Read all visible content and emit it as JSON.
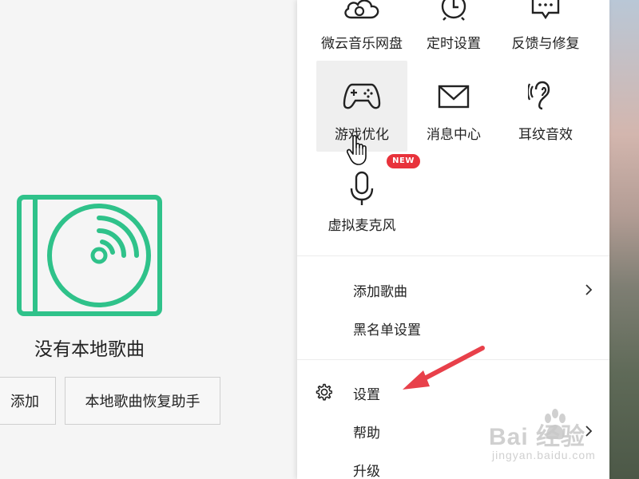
{
  "left_pane": {
    "empty_title": "没有本地歌曲",
    "add_label": "添加",
    "restore_label": "本地歌曲恢复助手"
  },
  "menu": {
    "tiles": [
      {
        "label": "微云音乐网盘",
        "icon": "cloud-icon"
      },
      {
        "label": "定时设置",
        "icon": "alarm-clock-icon"
      },
      {
        "label": "反馈与修复",
        "icon": "feedback-icon"
      },
      {
        "label": "游戏优化",
        "icon": "gamepad-icon",
        "hovered": true
      },
      {
        "label": "消息中心",
        "icon": "mail-icon"
      },
      {
        "label": "耳纹音效",
        "icon": "ear-icon"
      },
      {
        "label": "虚拟麦克风",
        "icon": "microphone-icon",
        "badge": "NEW"
      }
    ],
    "items": [
      {
        "label": "添加歌曲",
        "submenu": true
      },
      {
        "label": "黑名单设置",
        "submenu": false
      },
      {
        "label": "设置",
        "submenu": false,
        "icon": "gear-icon"
      },
      {
        "label": "帮助",
        "submenu": true
      },
      {
        "label": "升级",
        "submenu": false
      }
    ]
  },
  "watermark": {
    "brand": "Bai  经验",
    "site": "jingyan.baidu.com"
  },
  "colors": {
    "accent_green": "#2fc28a",
    "badge_red": "#e8323b",
    "annotation_red": "#e8404a"
  }
}
